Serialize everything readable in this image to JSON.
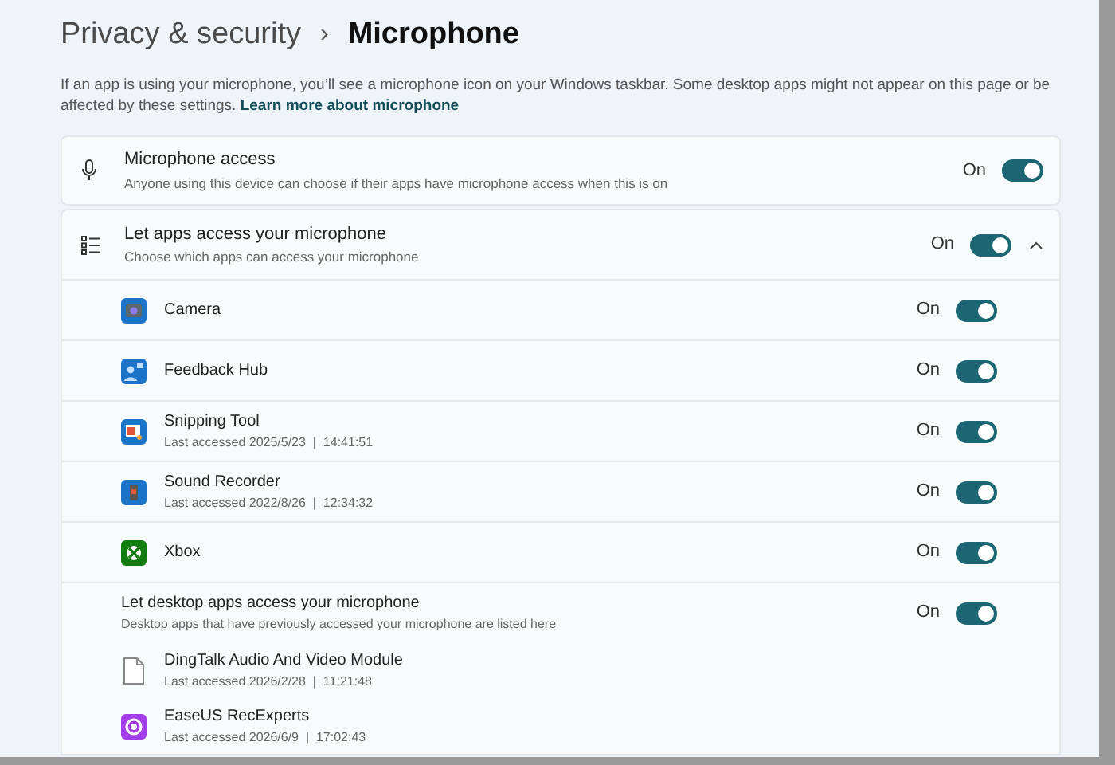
{
  "breadcrumb": {
    "parent": "Privacy & security",
    "separator": "›",
    "current": "Microphone"
  },
  "description": {
    "text": "If an app is using your microphone, you’ll see a microphone icon on your Windows taskbar. Some desktop apps might not appear on this page or be affected by these settings.",
    "link": "Learn more about microphone"
  },
  "microphone_access": {
    "title": "Microphone access",
    "subtitle": "Anyone using this device can choose if their apps have microphone access when this is on",
    "state_label": "On",
    "on": true
  },
  "app_access": {
    "title": "Let apps access your microphone",
    "subtitle": "Choose which apps can access your microphone",
    "state_label": "On",
    "on": true,
    "expanded": true,
    "apps": [
      {
        "kind": "camera",
        "name": "Camera",
        "state_label": "On",
        "on": true
      },
      {
        "kind": "feedback",
        "name": "Feedback Hub",
        "state_label": "On",
        "on": true
      },
      {
        "kind": "snipping",
        "name": "Snipping Tool",
        "last_accessed": "Last accessed 2025/5/23  |  14:41:51",
        "state_label": "On",
        "on": true
      },
      {
        "kind": "recorder",
        "name": "Sound Recorder",
        "last_accessed": "Last accessed 2022/8/26  |  12:34:32",
        "state_label": "On",
        "on": true
      },
      {
        "kind": "xbox",
        "name": "Xbox",
        "state_label": "On",
        "on": true
      }
    ],
    "desktop": {
      "title": "Let desktop apps access your microphone",
      "subtitle": "Desktop apps that have previously accessed your microphone are listed here",
      "state_label": "On",
      "on": true,
      "apps": [
        {
          "kind": "file",
          "name": "DingTalk Audio And Video Module",
          "last_accessed": "Last accessed 2026/2/28  |  11:21:48"
        },
        {
          "kind": "easeus",
          "name": "EaseUS RecExperts",
          "last_accessed": "Last accessed 2026/6/9  |  17:02:43"
        }
      ]
    }
  }
}
